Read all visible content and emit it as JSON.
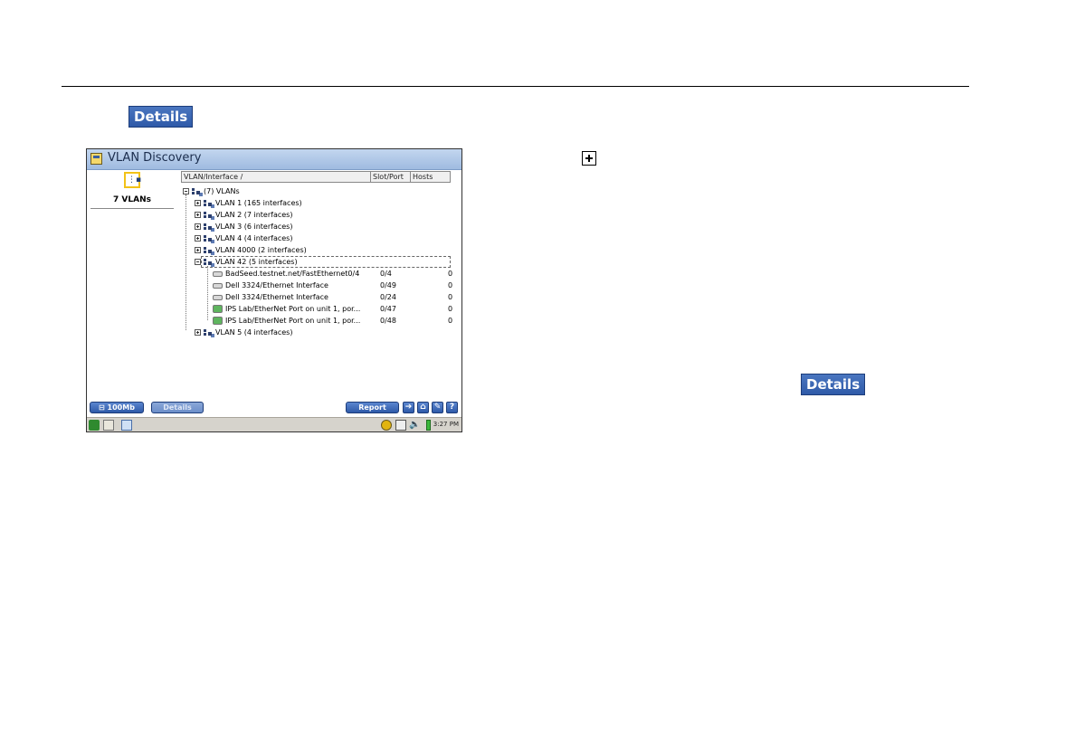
{
  "document": {
    "details_label_top": "Details",
    "details_label_right": "Details"
  },
  "window": {
    "title": "VLAN Discovery",
    "summary_label": "7 VLANs",
    "columns": [
      "VLAN/Interface  /",
      "Slot/Port",
      "Hosts"
    ],
    "tree": {
      "root": "(7) VLANs",
      "vlans": [
        {
          "label": "VLAN 1 (165 interfaces)",
          "expanded": false
        },
        {
          "label": "VLAN 2 (7 interfaces)",
          "expanded": false
        },
        {
          "label": "VLAN 3 (6 interfaces)",
          "expanded": false
        },
        {
          "label": "VLAN 4 (4 interfaces)",
          "expanded": false
        },
        {
          "label": "VLAN 4000 (2 interfaces)",
          "expanded": false
        },
        {
          "label": "VLAN 42 (5 interfaces)",
          "expanded": true
        },
        {
          "label": "VLAN 5 (4 interfaces)",
          "expanded": false
        }
      ],
      "interfaces": [
        {
          "name": "BadSeed.testnet.net/FastEthernet0/4",
          "slot": "0/4",
          "hosts": "0",
          "icon": "grey"
        },
        {
          "name": "Dell 3324/Ethernet Interface",
          "slot": "0/49",
          "hosts": "0",
          "icon": "grey"
        },
        {
          "name": "Dell 3324/Ethernet Interface",
          "slot": "0/24",
          "hosts": "0",
          "icon": "grey"
        },
        {
          "name": "IPS Lab/EtherNet Port on unit 1, por...",
          "slot": "0/47",
          "hosts": "0",
          "icon": "green"
        },
        {
          "name": "IPS Lab/EtherNet Port on unit 1, por...",
          "slot": "0/48",
          "hosts": "0",
          "icon": "green"
        }
      ]
    },
    "toolbar": {
      "speed_label": "100Mb",
      "details_label": "Details",
      "report_label": "Report",
      "help_label": "?"
    },
    "statusbar": {
      "time": "3:27 PM"
    }
  }
}
